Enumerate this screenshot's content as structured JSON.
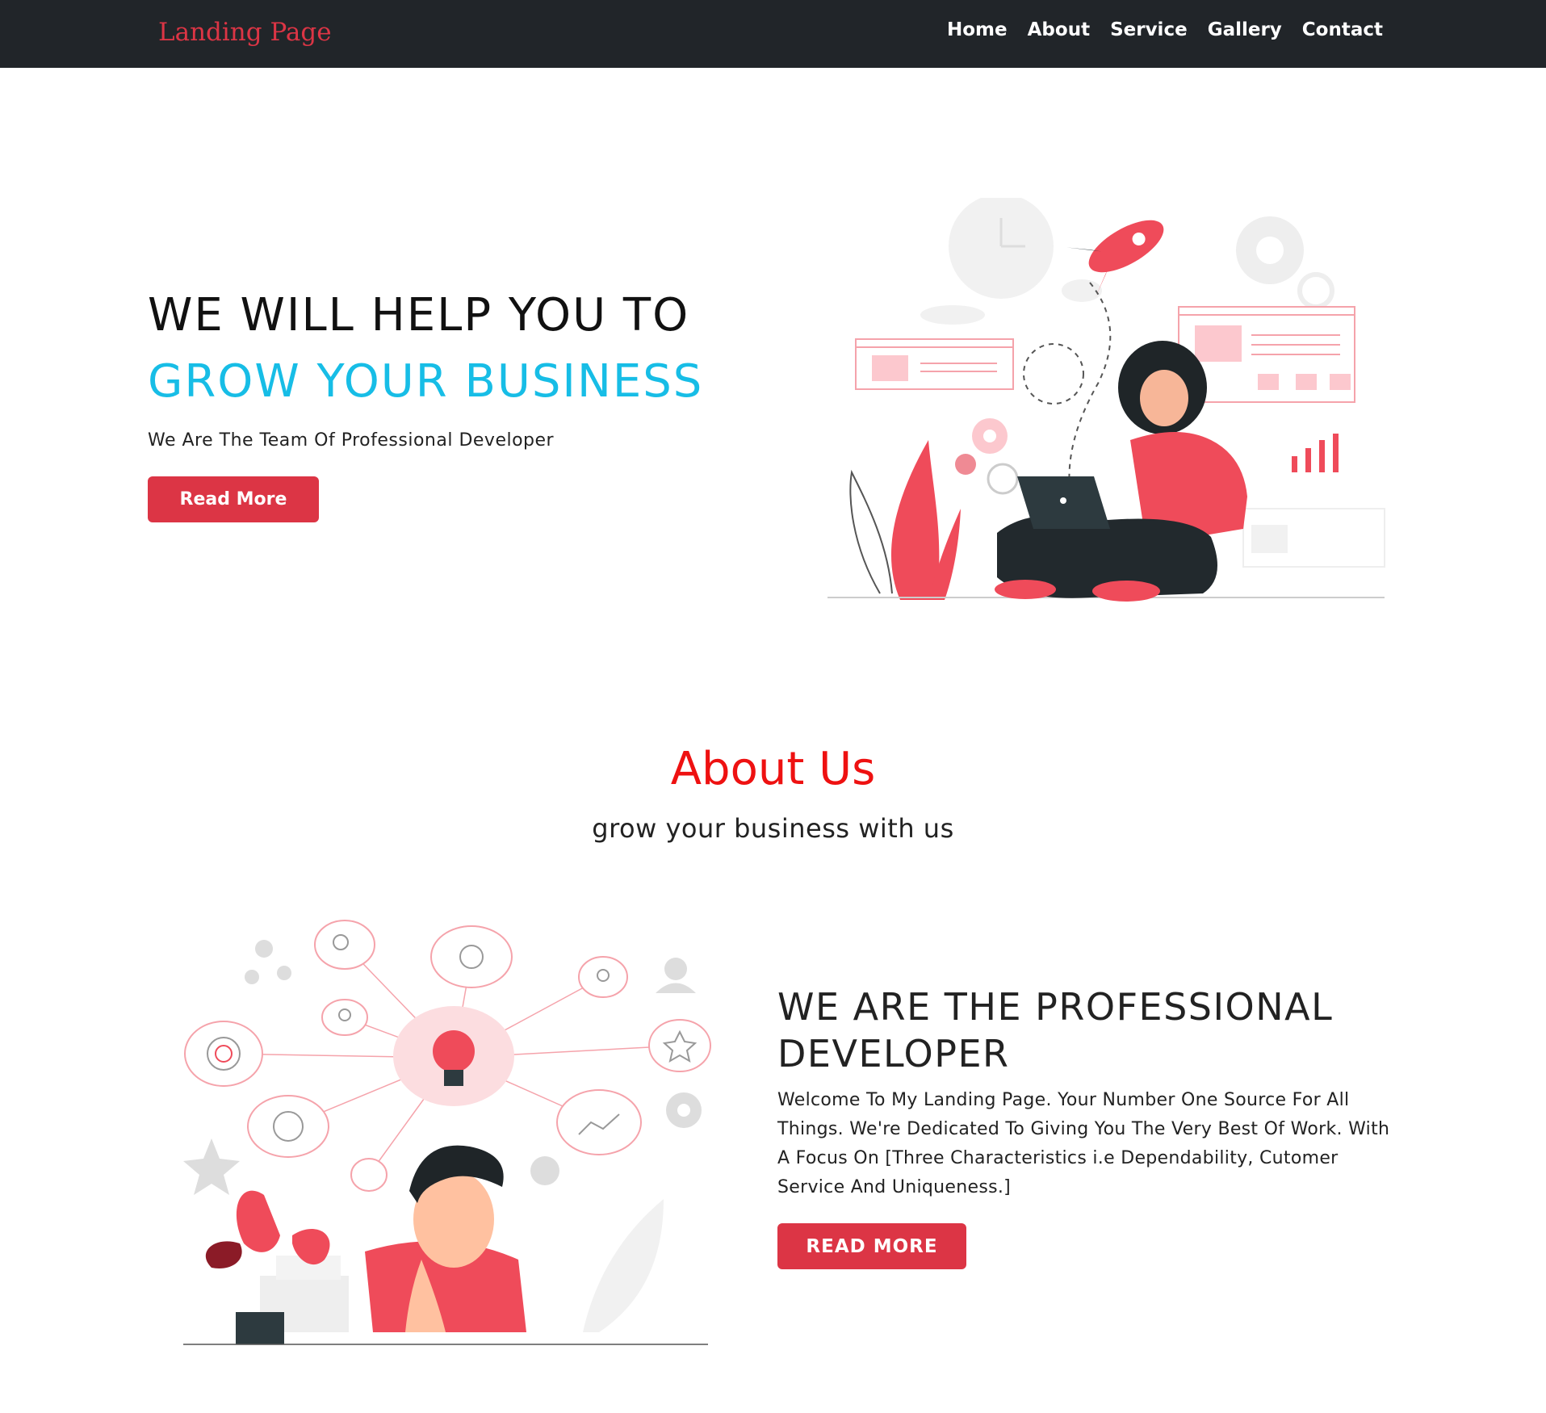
{
  "navbar": {
    "brand": "Landing Page",
    "links": [
      "Home",
      "About",
      "Service",
      "Gallery",
      "Contact"
    ]
  },
  "hero": {
    "title_line1": "WE WILL HELP YOU TO",
    "title_line2": "GROW YOUR BUSINESS",
    "subtitle": "We Are The Team Of Professional Developer",
    "button_label": "Read More"
  },
  "about": {
    "title": "About Us",
    "subtitle": "grow your business with us",
    "heading": "WE ARE THE PROFESSIONAL DEVELOPER",
    "body": "Welcome To My Landing Page. Your Number One Source For All Things. We're Dedicated To Giving You The Very Best Of Work. With A Focus On [Three Characteristics i.e Dependability, Cutomer Service And Uniqueness.]",
    "button_label": "READ MORE"
  },
  "colors": {
    "accent": "#dc3545",
    "highlight": "#17bde6",
    "nav_bg": "#212529",
    "about_title": "#ee1111"
  }
}
